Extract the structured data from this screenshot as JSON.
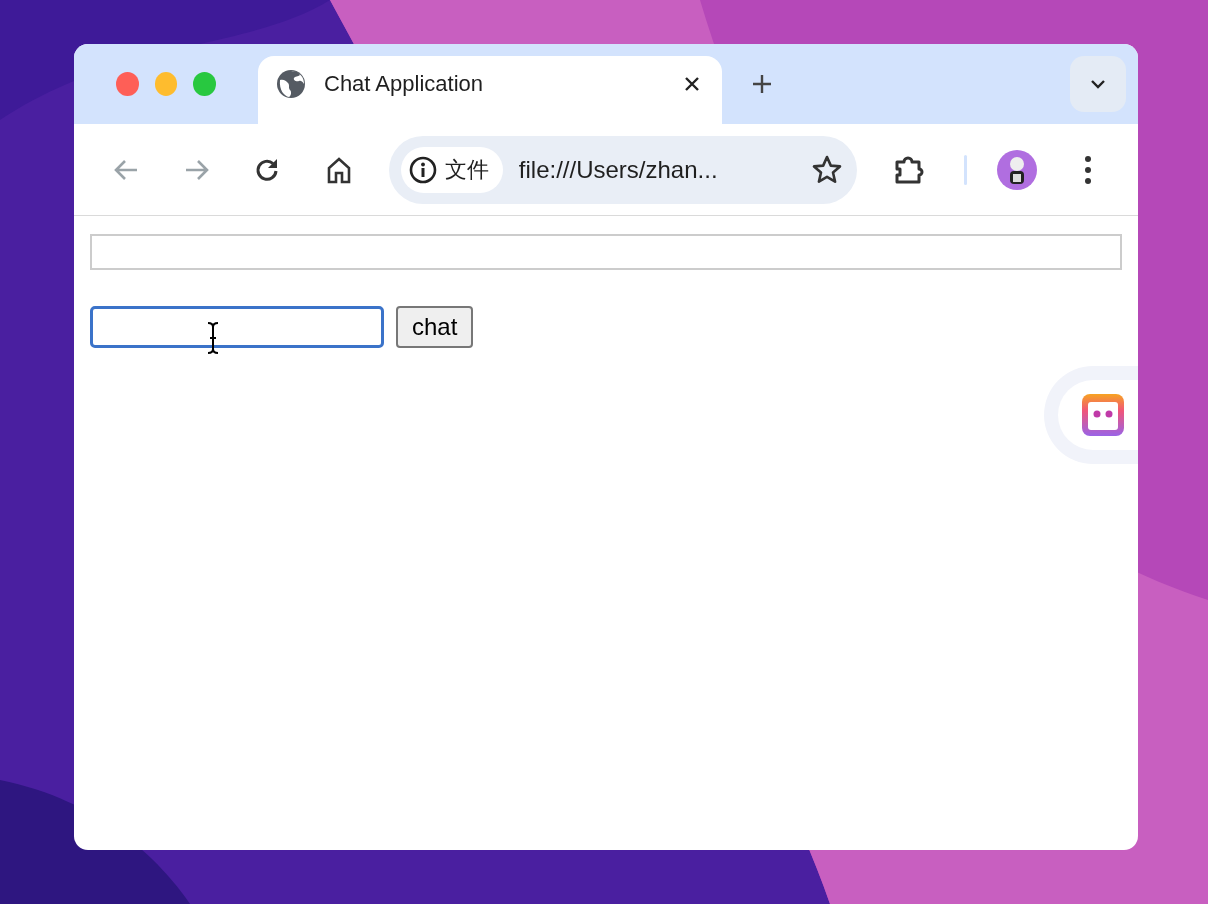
{
  "tabs": [
    {
      "title": "Chat Application",
      "selected": true
    }
  ],
  "toolbar": {
    "back_disabled": true,
    "forward_disabled": true,
    "security_label": "文件",
    "url": "file:///Users/zhan..."
  },
  "page": {
    "message_field": {
      "focused": true
    },
    "chat_button": {
      "label": "chat"
    }
  }
}
